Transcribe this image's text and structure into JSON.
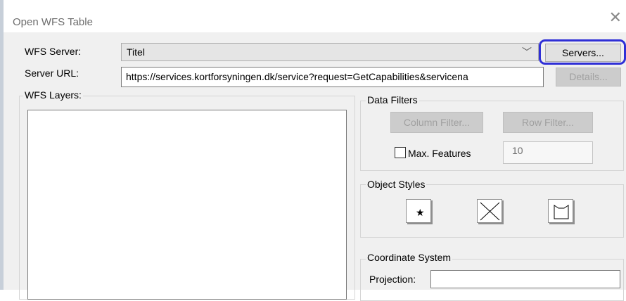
{
  "dialog": {
    "title": "Open WFS Table",
    "close_icon": "close-icon"
  },
  "wfs_server": {
    "label": "WFS Server:",
    "value": "Titel",
    "dropdown_icon": "chevron-down-icon",
    "servers_button": "Servers..."
  },
  "server_url": {
    "label": "Server URL:",
    "value": "https://services.kortforsyningen.dk/service?request=GetCapabilities&servicena",
    "details_button": "Details..."
  },
  "wfs_layers": {
    "label": "WFS Layers:",
    "items": []
  },
  "data_filters": {
    "label": "Data Filters",
    "column_filter_button": "Column Filter...",
    "row_filter_button": "Row Filter...",
    "max_features_label": "Max. Features",
    "max_features_checked": false,
    "max_features_value": "10"
  },
  "object_styles": {
    "label": "Object Styles",
    "buttons": [
      "symbol-style-icon",
      "line-style-icon",
      "region-style-icon"
    ]
  },
  "coordinate_system": {
    "label": "Coordinate System",
    "projection_label": "Projection:",
    "projection_value": ""
  },
  "colors": {
    "dialog_bg": "#f0f0f0",
    "highlight": "#2f2fd6"
  }
}
